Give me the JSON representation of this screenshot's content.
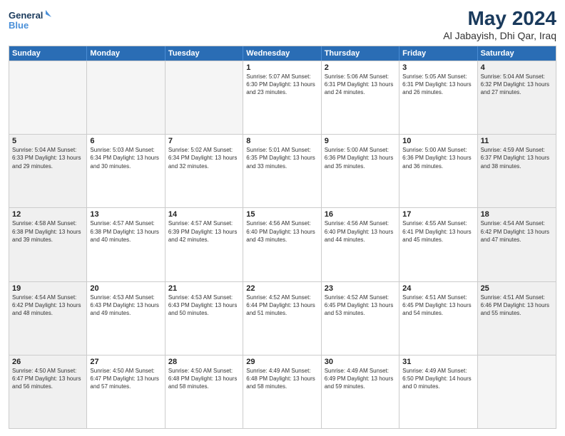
{
  "logo": {
    "line1": "General",
    "line2": "Blue"
  },
  "title": "May 2024",
  "subtitle": "Al Jabayish, Dhi Qar, Iraq",
  "header_days": [
    "Sunday",
    "Monday",
    "Tuesday",
    "Wednesday",
    "Thursday",
    "Friday",
    "Saturday"
  ],
  "weeks": [
    [
      {
        "day": "",
        "info": "",
        "empty": true
      },
      {
        "day": "",
        "info": "",
        "empty": true
      },
      {
        "day": "",
        "info": "",
        "empty": true
      },
      {
        "day": "1",
        "info": "Sunrise: 5:07 AM\nSunset: 6:30 PM\nDaylight: 13 hours\nand 23 minutes."
      },
      {
        "day": "2",
        "info": "Sunrise: 5:06 AM\nSunset: 6:31 PM\nDaylight: 13 hours\nand 24 minutes."
      },
      {
        "day": "3",
        "info": "Sunrise: 5:05 AM\nSunset: 6:31 PM\nDaylight: 13 hours\nand 26 minutes."
      },
      {
        "day": "4",
        "info": "Sunrise: 5:04 AM\nSunset: 6:32 PM\nDaylight: 13 hours\nand 27 minutes.",
        "shaded": true
      }
    ],
    [
      {
        "day": "5",
        "info": "Sunrise: 5:04 AM\nSunset: 6:33 PM\nDaylight: 13 hours\nand 29 minutes.",
        "shaded": true
      },
      {
        "day": "6",
        "info": "Sunrise: 5:03 AM\nSunset: 6:34 PM\nDaylight: 13 hours\nand 30 minutes."
      },
      {
        "day": "7",
        "info": "Sunrise: 5:02 AM\nSunset: 6:34 PM\nDaylight: 13 hours\nand 32 minutes."
      },
      {
        "day": "8",
        "info": "Sunrise: 5:01 AM\nSunset: 6:35 PM\nDaylight: 13 hours\nand 33 minutes."
      },
      {
        "day": "9",
        "info": "Sunrise: 5:00 AM\nSunset: 6:36 PM\nDaylight: 13 hours\nand 35 minutes."
      },
      {
        "day": "10",
        "info": "Sunrise: 5:00 AM\nSunset: 6:36 PM\nDaylight: 13 hours\nand 36 minutes."
      },
      {
        "day": "11",
        "info": "Sunrise: 4:59 AM\nSunset: 6:37 PM\nDaylight: 13 hours\nand 38 minutes.",
        "shaded": true
      }
    ],
    [
      {
        "day": "12",
        "info": "Sunrise: 4:58 AM\nSunset: 6:38 PM\nDaylight: 13 hours\nand 39 minutes.",
        "shaded": true
      },
      {
        "day": "13",
        "info": "Sunrise: 4:57 AM\nSunset: 6:38 PM\nDaylight: 13 hours\nand 40 minutes."
      },
      {
        "day": "14",
        "info": "Sunrise: 4:57 AM\nSunset: 6:39 PM\nDaylight: 13 hours\nand 42 minutes."
      },
      {
        "day": "15",
        "info": "Sunrise: 4:56 AM\nSunset: 6:40 PM\nDaylight: 13 hours\nand 43 minutes."
      },
      {
        "day": "16",
        "info": "Sunrise: 4:56 AM\nSunset: 6:40 PM\nDaylight: 13 hours\nand 44 minutes."
      },
      {
        "day": "17",
        "info": "Sunrise: 4:55 AM\nSunset: 6:41 PM\nDaylight: 13 hours\nand 45 minutes."
      },
      {
        "day": "18",
        "info": "Sunrise: 4:54 AM\nSunset: 6:42 PM\nDaylight: 13 hours\nand 47 minutes.",
        "shaded": true
      }
    ],
    [
      {
        "day": "19",
        "info": "Sunrise: 4:54 AM\nSunset: 6:42 PM\nDaylight: 13 hours\nand 48 minutes.",
        "shaded": true
      },
      {
        "day": "20",
        "info": "Sunrise: 4:53 AM\nSunset: 6:43 PM\nDaylight: 13 hours\nand 49 minutes."
      },
      {
        "day": "21",
        "info": "Sunrise: 4:53 AM\nSunset: 6:43 PM\nDaylight: 13 hours\nand 50 minutes."
      },
      {
        "day": "22",
        "info": "Sunrise: 4:52 AM\nSunset: 6:44 PM\nDaylight: 13 hours\nand 51 minutes."
      },
      {
        "day": "23",
        "info": "Sunrise: 4:52 AM\nSunset: 6:45 PM\nDaylight: 13 hours\nand 53 minutes."
      },
      {
        "day": "24",
        "info": "Sunrise: 4:51 AM\nSunset: 6:45 PM\nDaylight: 13 hours\nand 54 minutes."
      },
      {
        "day": "25",
        "info": "Sunrise: 4:51 AM\nSunset: 6:46 PM\nDaylight: 13 hours\nand 55 minutes.",
        "shaded": true
      }
    ],
    [
      {
        "day": "26",
        "info": "Sunrise: 4:50 AM\nSunset: 6:47 PM\nDaylight: 13 hours\nand 56 minutes.",
        "shaded": true
      },
      {
        "day": "27",
        "info": "Sunrise: 4:50 AM\nSunset: 6:47 PM\nDaylight: 13 hours\nand 57 minutes."
      },
      {
        "day": "28",
        "info": "Sunrise: 4:50 AM\nSunset: 6:48 PM\nDaylight: 13 hours\nand 58 minutes."
      },
      {
        "day": "29",
        "info": "Sunrise: 4:49 AM\nSunset: 6:48 PM\nDaylight: 13 hours\nand 58 minutes."
      },
      {
        "day": "30",
        "info": "Sunrise: 4:49 AM\nSunset: 6:49 PM\nDaylight: 13 hours\nand 59 minutes."
      },
      {
        "day": "31",
        "info": "Sunrise: 4:49 AM\nSunset: 6:50 PM\nDaylight: 14 hours\nand 0 minutes."
      },
      {
        "day": "",
        "info": "",
        "empty": true
      }
    ]
  ]
}
